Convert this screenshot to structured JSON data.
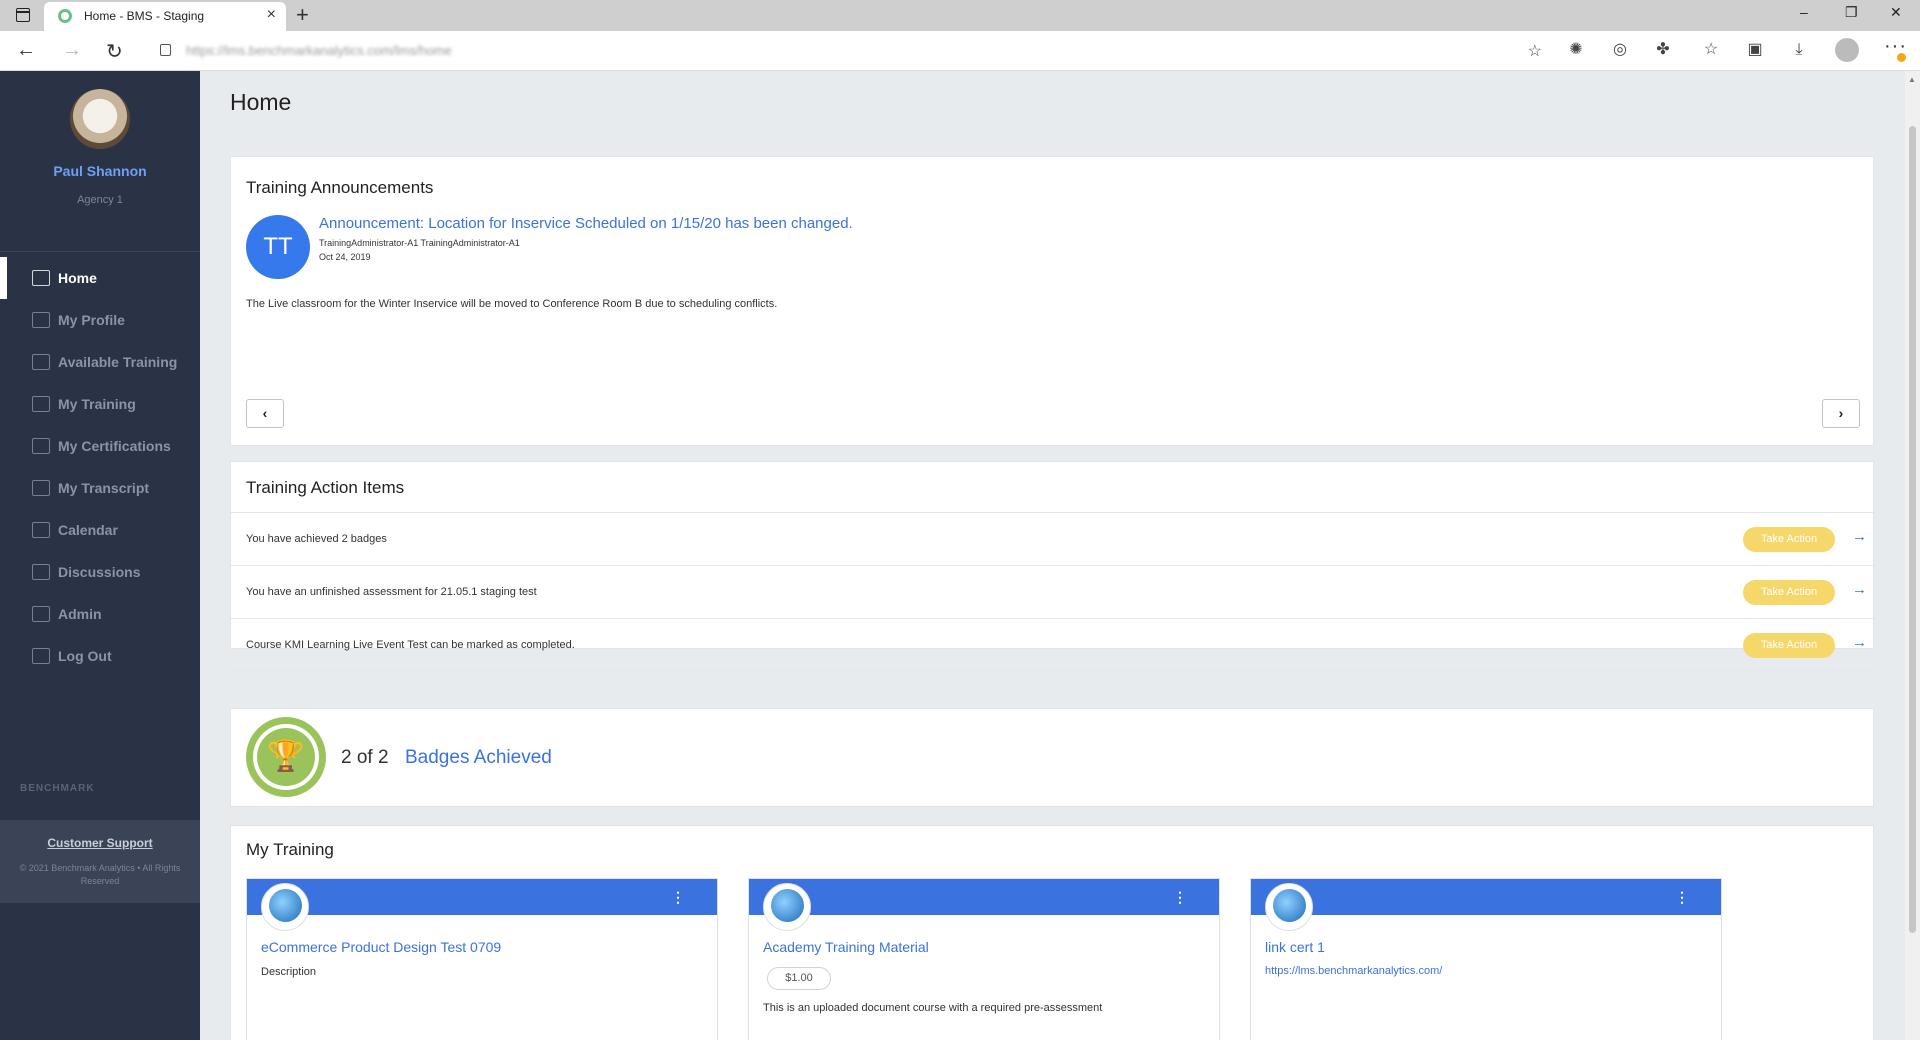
{
  "browser": {
    "tab_title": "Home - BMS - Staging",
    "url": "https://lms.benchmarkanalytics.com/lms/home",
    "new_tab": "+",
    "close": "×",
    "minimize": "–",
    "restore": "❐",
    "window_close": "✕"
  },
  "user": {
    "name": "Paul Shannon",
    "agency": "Agency 1"
  },
  "nav": [
    {
      "label": "Home",
      "icon": "dashboard-icon",
      "active": true
    },
    {
      "label": "My Profile",
      "icon": "users-icon"
    },
    {
      "label": "Available Training",
      "icon": "catalog-icon"
    },
    {
      "label": "My Training",
      "icon": "list-icon"
    },
    {
      "label": "My Certifications",
      "icon": "certificate-icon"
    },
    {
      "label": "My Transcript",
      "icon": "transcript-icon"
    },
    {
      "label": "Calendar",
      "icon": "calendar-icon"
    },
    {
      "label": "Discussions",
      "icon": "chat-icon"
    },
    {
      "label": "Admin",
      "icon": "wrench-icon"
    },
    {
      "label": "Log Out",
      "icon": "logout-icon"
    }
  ],
  "sidebar_footer": {
    "logo_text": "BENCHMARK",
    "support": "Customer Support",
    "copyright": "© 2021 Benchmark Analytics • All Rights Reserved"
  },
  "page": {
    "title": "Home"
  },
  "announcements": {
    "title": "Training Announcements",
    "initials": "TT",
    "item_title": "Announcement: Location for Inservice Scheduled on 1/15/20 has been changed.",
    "author": "TrainingAdministrator-A1 TrainingAdministrator-A1",
    "date": "Oct 24, 2019",
    "body": "The Live classroom for the Winter Inservice will be moved to Conference Room B due to scheduling conflicts.",
    "prev": "‹",
    "next": "›"
  },
  "action_items": {
    "title": "Training Action Items",
    "button": "Take Action",
    "arrow": "→",
    "rows": [
      "You have achieved 2 badges",
      "You have an unfinished assessment for 21.05.1 staging test",
      "Course KMI Learning Live Event Test can be marked as completed."
    ]
  },
  "badges": {
    "count": "2 of 2",
    "label": "Badges Achieved",
    "icon": "trophy-icon"
  },
  "my_training": {
    "title": "My Training",
    "cards": [
      {
        "title": "eCommerce Product Design Test 0709",
        "description": "Description"
      },
      {
        "title": "Academy Training Material",
        "price": "$1.00",
        "description": "This is an uploaded document course with a required pre-assessment"
      },
      {
        "title": "link cert 1",
        "link": "https://lms.benchmarkanalytics.com/"
      }
    ]
  },
  "colors": {
    "accent": "#3a72e0",
    "sidebar": "#2a3346",
    "take_action": "#f5d76a",
    "badge": "#9ac35c"
  }
}
